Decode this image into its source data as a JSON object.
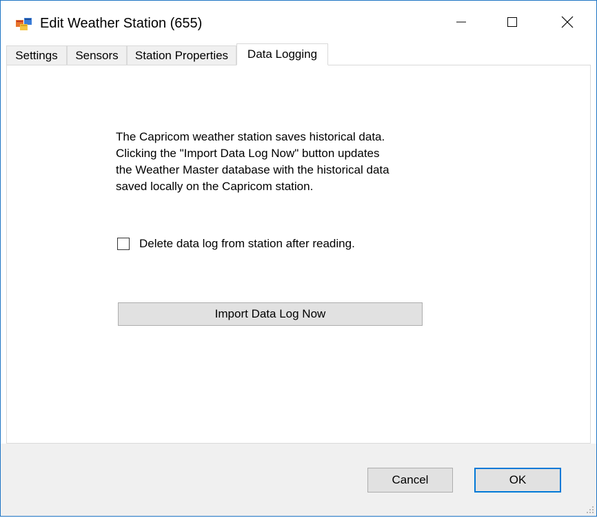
{
  "window": {
    "title": "Edit Weather Station (655)"
  },
  "tabs": [
    {
      "label": "Settings"
    },
    {
      "label": "Sensors"
    },
    {
      "label": "Station Properties"
    },
    {
      "label": "Data Logging"
    }
  ],
  "active_tab": "Data Logging",
  "data_logging": {
    "description": "The Capricom weather station saves historical data.\nClicking the \"Import Data Log Now\" button updates\nthe Weather Master database with the historical data\nsaved locally on the Capricom station.",
    "delete_checkbox_label": "Delete data log from station after reading.",
    "delete_checkbox_checked": false,
    "import_button_label": "Import Data Log Now"
  },
  "footer": {
    "cancel_label": "Cancel",
    "ok_label": "OK"
  },
  "colors": {
    "window_border": "#1c73c4",
    "default_button_border": "#0078d7",
    "button_face": "#e1e1e1",
    "footer_background": "#f0f0f0"
  },
  "icons": {
    "app": "form-window-icon",
    "minimize": "minimize-icon",
    "maximize": "maximize-icon",
    "close": "close-icon"
  }
}
